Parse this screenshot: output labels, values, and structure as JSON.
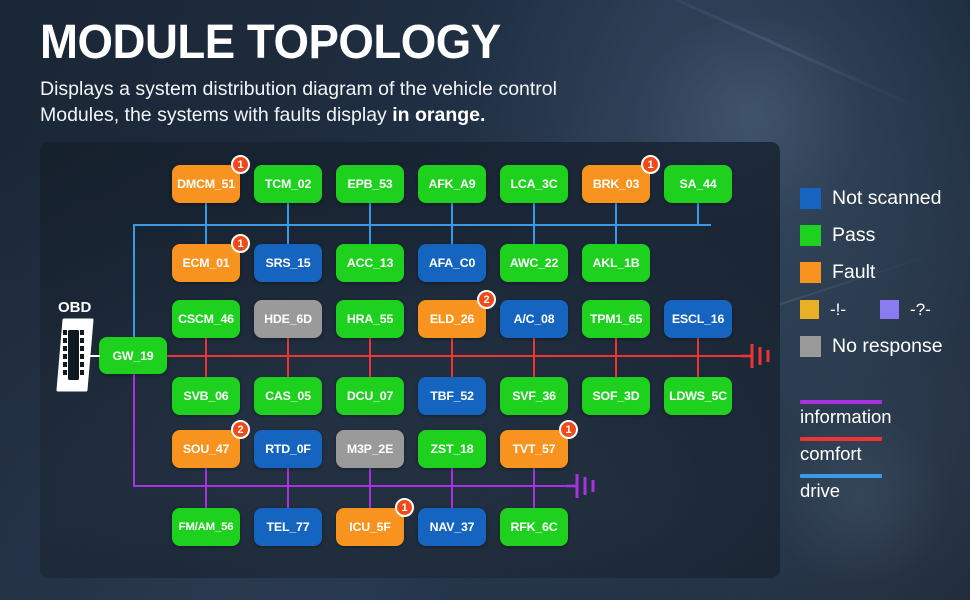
{
  "header": {
    "title": "MODULE TOPOLOGY",
    "subtitle_line1": "Displays a system distribution diagram of the vehicle control",
    "subtitle_line2_prefix": "Modules, the systems with faults display ",
    "subtitle_line2_bold": "in orange."
  },
  "obd": {
    "label": "OBD"
  },
  "colors": {
    "not_scanned": "#1565c0",
    "pass": "#1fd11f",
    "fault": "#f7931e",
    "warning": "#eab024",
    "unknown": "#8b7bf0",
    "no_response": "#9a9a9a",
    "information_line": "#a832e0",
    "comfort_line": "#ef3434",
    "drive_line": "#3a9ae8",
    "badge": "#f04a18"
  },
  "legend": {
    "items": [
      {
        "label": "Not scanned",
        "color": "#1565c0"
      },
      {
        "label": "Pass",
        "color": "#1fd11f"
      },
      {
        "label": "Fault",
        "color": "#f7931e"
      }
    ],
    "small_items": [
      {
        "label": "-!-",
        "color": "#eab024"
      },
      {
        "label": "-?-",
        "color": "#8b7bf0"
      }
    ],
    "last_item": {
      "label": "No response",
      "color": "#9a9a9a"
    }
  },
  "line_legend": [
    {
      "label": "information",
      "color": "#a832e0"
    },
    {
      "label": "comfort",
      "color": "#ef3434"
    },
    {
      "label": "drive",
      "color": "#3a9ae8"
    }
  ],
  "gateway": {
    "id": "GW_19",
    "status": "pass"
  },
  "rows": [
    {
      "bus": "drive",
      "modules": [
        {
          "id": "DMCM_51",
          "status": "fault",
          "badge": "1"
        },
        {
          "id": "TCM_02",
          "status": "pass"
        },
        {
          "id": "EPB_53",
          "status": "pass"
        },
        {
          "id": "AFK_A9",
          "status": "pass"
        },
        {
          "id": "LCA_3C",
          "status": "pass"
        },
        {
          "id": "BRK_03",
          "status": "fault",
          "badge": "1"
        },
        {
          "id": "SA_44",
          "status": "pass"
        }
      ]
    },
    {
      "bus": "drive",
      "modules": [
        {
          "id": "ECM_01",
          "status": "fault",
          "badge": "1"
        },
        {
          "id": "SRS_15",
          "status": "not_scanned"
        },
        {
          "id": "ACC_13",
          "status": "pass"
        },
        {
          "id": "AFA_C0",
          "status": "not_scanned"
        },
        {
          "id": "AWC_22",
          "status": "pass"
        },
        {
          "id": "AKL_1B",
          "status": "pass"
        }
      ]
    },
    {
      "bus": "comfort",
      "modules": [
        {
          "id": "CSCM_46",
          "status": "pass"
        },
        {
          "id": "HDE_6D",
          "status": "no_response"
        },
        {
          "id": "HRA_55",
          "status": "pass"
        },
        {
          "id": "ELD_26",
          "status": "fault",
          "badge": "2"
        },
        {
          "id": "A/C_08",
          "status": "not_scanned"
        },
        {
          "id": "TPM1_65",
          "status": "pass"
        },
        {
          "id": "ESCL_16",
          "status": "not_scanned"
        }
      ]
    },
    {
      "bus": "comfort",
      "modules": [
        {
          "id": "SVB_06",
          "status": "pass"
        },
        {
          "id": "CAS_05",
          "status": "pass"
        },
        {
          "id": "DCU_07",
          "status": "pass"
        },
        {
          "id": "TBF_52",
          "status": "not_scanned"
        },
        {
          "id": "SVF_36",
          "status": "pass"
        },
        {
          "id": "SOF_3D",
          "status": "pass"
        },
        {
          "id": "LDWS_5C",
          "status": "pass"
        }
      ]
    },
    {
      "bus": "information",
      "modules": [
        {
          "id": "SOU_47",
          "status": "fault",
          "badge": "2"
        },
        {
          "id": "RTD_0F",
          "status": "not_scanned"
        },
        {
          "id": "M3P_2E",
          "status": "no_response"
        },
        {
          "id": "ZST_18",
          "status": "pass"
        },
        {
          "id": "TVT_57",
          "status": "fault",
          "badge": "1"
        }
      ]
    },
    {
      "bus": "information",
      "modules": [
        {
          "id": "FM/AM_56",
          "status": "pass"
        },
        {
          "id": "TEL_77",
          "status": "not_scanned"
        },
        {
          "id": "ICU_5F",
          "status": "fault",
          "badge": "1"
        },
        {
          "id": "NAV_37",
          "status": "not_scanned"
        },
        {
          "id": "RFK_6C",
          "status": "pass"
        }
      ]
    }
  ]
}
